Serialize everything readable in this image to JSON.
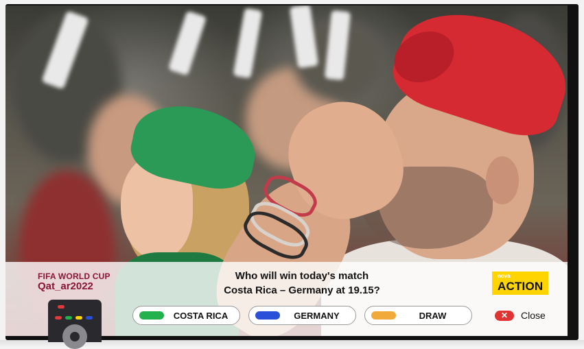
{
  "brand": {
    "event_line1": "FIFA WORLD CUP",
    "event_line2": "Qat_ar2022"
  },
  "question": {
    "line1": "Who will win today's match",
    "line2": "Costa Rica – Germany at 19.15?"
  },
  "channel": {
    "small": "nova",
    "big": "ACTION",
    "color": "#ffd400"
  },
  "options": [
    {
      "label": "COSTA RICA",
      "color": "#22b14c"
    },
    {
      "label": "GERMANY",
      "color": "#2a4fd8"
    },
    {
      "label": "DRAW",
      "color": "#f2a93b"
    }
  ],
  "close": {
    "icon": "x-icon",
    "glyph": "✕",
    "label": "Close",
    "color": "#e23333"
  },
  "remote": {
    "icon": "remote-control-icon",
    "keys": [
      "#e03a3a",
      "#22b14c",
      "#ffd400",
      "#2a4fd8"
    ]
  },
  "background": {
    "subject": "football-fans-photo"
  }
}
